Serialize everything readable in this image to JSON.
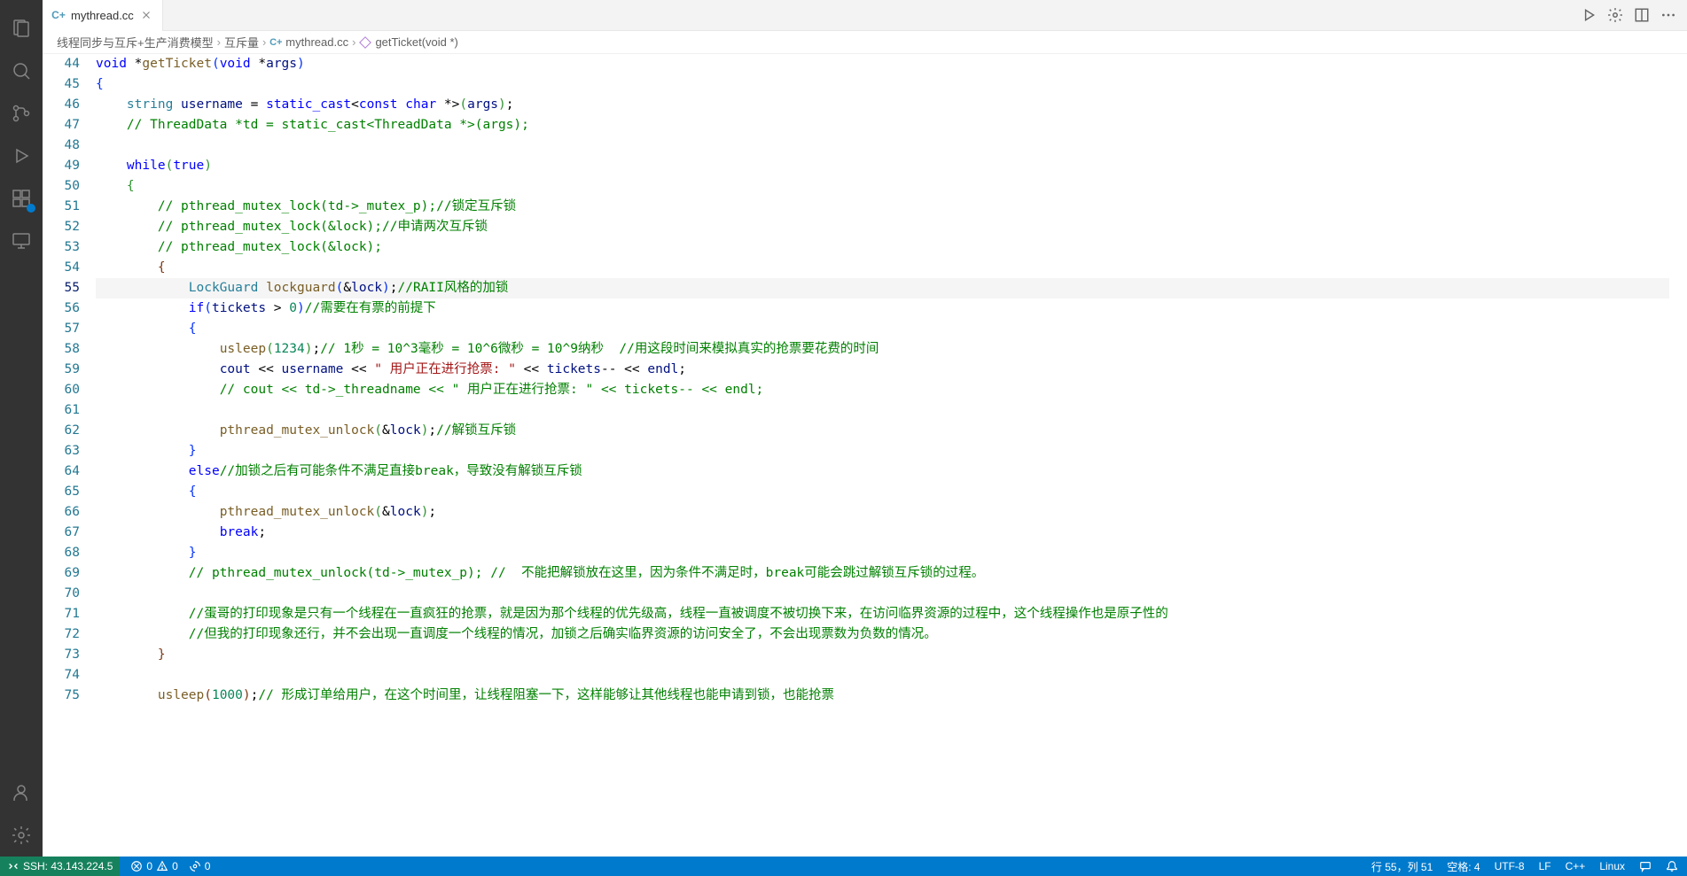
{
  "tab": {
    "filename": "mythread.cc",
    "iconLabel": "C+"
  },
  "breadcrumb": {
    "items": [
      {
        "label": "线程同步与互斥+生产消费模型",
        "type": "folder"
      },
      {
        "label": "互斥量",
        "type": "folder"
      },
      {
        "label": "mythread.cc",
        "type": "file",
        "icon": "C+"
      },
      {
        "label": "getTicket(void *)",
        "type": "symbol"
      }
    ]
  },
  "code": {
    "startLine": 44,
    "currentLine": 55,
    "lines": [
      {
        "num": 44,
        "tokens": [
          {
            "t": "kw",
            "v": "void"
          },
          {
            "t": "op",
            "v": " *"
          },
          {
            "t": "func",
            "v": "getTicket"
          },
          {
            "t": "paren",
            "v": "("
          },
          {
            "t": "kw",
            "v": "void"
          },
          {
            "t": "op",
            "v": " *"
          },
          {
            "t": "var",
            "v": "args"
          },
          {
            "t": "paren",
            "v": ")"
          }
        ]
      },
      {
        "num": 45,
        "tokens": [
          {
            "t": "paren",
            "v": "{"
          }
        ]
      },
      {
        "num": 46,
        "indent": 1,
        "tokens": [
          {
            "t": "type",
            "v": "string"
          },
          {
            "t": "op",
            "v": " "
          },
          {
            "t": "var",
            "v": "username"
          },
          {
            "t": "op",
            "v": " = "
          },
          {
            "t": "kw",
            "v": "static_cast"
          },
          {
            "t": "op",
            "v": "<"
          },
          {
            "t": "kw",
            "v": "const"
          },
          {
            "t": "op",
            "v": " "
          },
          {
            "t": "kw",
            "v": "char"
          },
          {
            "t": "op",
            "v": " *>"
          },
          {
            "t": "paren2",
            "v": "("
          },
          {
            "t": "var",
            "v": "args"
          },
          {
            "t": "paren2",
            "v": ")"
          },
          {
            "t": "op",
            "v": ";"
          }
        ]
      },
      {
        "num": 47,
        "indent": 1,
        "tokens": [
          {
            "t": "comment",
            "v": "// ThreadData *td = static_cast<ThreadData *>(args);"
          }
        ]
      },
      {
        "num": 48,
        "tokens": []
      },
      {
        "num": 49,
        "indent": 1,
        "tokens": [
          {
            "t": "kw",
            "v": "while"
          },
          {
            "t": "paren2",
            "v": "("
          },
          {
            "t": "kw",
            "v": "true"
          },
          {
            "t": "paren2",
            "v": ")"
          }
        ]
      },
      {
        "num": 50,
        "indent": 1,
        "tokens": [
          {
            "t": "paren2",
            "v": "{"
          }
        ]
      },
      {
        "num": 51,
        "indent": 2,
        "tokens": [
          {
            "t": "comment",
            "v": "// pthread_mutex_lock(td->_mutex_p);//锁定互斥锁"
          }
        ]
      },
      {
        "num": 52,
        "indent": 2,
        "tokens": [
          {
            "t": "comment",
            "v": "// pthread_mutex_lock(&lock);//申请两次互斥锁"
          }
        ]
      },
      {
        "num": 53,
        "indent": 2,
        "tokens": [
          {
            "t": "comment",
            "v": "// pthread_mutex_lock(&lock);"
          }
        ]
      },
      {
        "num": 54,
        "indent": 2,
        "tokens": [
          {
            "t": "paren3",
            "v": "{"
          }
        ]
      },
      {
        "num": 55,
        "indent": 3,
        "highlighted": true,
        "tokens": [
          {
            "t": "type",
            "v": "LockGuard"
          },
          {
            "t": "op",
            "v": " "
          },
          {
            "t": "func",
            "v": "lockguard"
          },
          {
            "t": "paren",
            "v": "("
          },
          {
            "t": "op",
            "v": "&"
          },
          {
            "t": "var",
            "v": "lock"
          },
          {
            "t": "paren",
            "v": ")"
          },
          {
            "t": "op",
            "v": ";"
          },
          {
            "t": "comment",
            "v": "//RAII风格的加锁"
          }
        ]
      },
      {
        "num": 56,
        "indent": 3,
        "tokens": [
          {
            "t": "kw",
            "v": "if"
          },
          {
            "t": "paren",
            "v": "("
          },
          {
            "t": "var",
            "v": "tickets"
          },
          {
            "t": "op",
            "v": " > "
          },
          {
            "t": "num",
            "v": "0"
          },
          {
            "t": "paren",
            "v": ")"
          },
          {
            "t": "comment",
            "v": "//需要在有票的前提下"
          }
        ]
      },
      {
        "num": 57,
        "indent": 3,
        "tokens": [
          {
            "t": "paren",
            "v": "{"
          }
        ]
      },
      {
        "num": 58,
        "indent": 4,
        "tokens": [
          {
            "t": "func",
            "v": "usleep"
          },
          {
            "t": "paren2",
            "v": "("
          },
          {
            "t": "num",
            "v": "1234"
          },
          {
            "t": "paren2",
            "v": ")"
          },
          {
            "t": "op",
            "v": ";"
          },
          {
            "t": "comment",
            "v": "// 1秒 = 10^3毫秒 = 10^6微秒 = 10^9纳秒  //用这段时间来模拟真实的抢票要花费的时间"
          }
        ]
      },
      {
        "num": 59,
        "indent": 4,
        "tokens": [
          {
            "t": "var",
            "v": "cout"
          },
          {
            "t": "op",
            "v": " << "
          },
          {
            "t": "var",
            "v": "username"
          },
          {
            "t": "op",
            "v": " << "
          },
          {
            "t": "str",
            "v": "\" 用户正在进行抢票: \""
          },
          {
            "t": "op",
            "v": " << "
          },
          {
            "t": "var",
            "v": "tickets"
          },
          {
            "t": "op",
            "v": "-- << "
          },
          {
            "t": "var",
            "v": "endl"
          },
          {
            "t": "op",
            "v": ";"
          }
        ]
      },
      {
        "num": 60,
        "indent": 4,
        "tokens": [
          {
            "t": "comment",
            "v": "// cout << td->_threadname << \" 用户正在进行抢票: \" << tickets-- << endl;"
          }
        ]
      },
      {
        "num": 61,
        "tokens": []
      },
      {
        "num": 62,
        "indent": 4,
        "tokens": [
          {
            "t": "func",
            "v": "pthread_mutex_unlock"
          },
          {
            "t": "paren2",
            "v": "("
          },
          {
            "t": "op",
            "v": "&"
          },
          {
            "t": "var",
            "v": "lock"
          },
          {
            "t": "paren2",
            "v": ")"
          },
          {
            "t": "op",
            "v": ";"
          },
          {
            "t": "comment",
            "v": "//解锁互斥锁"
          }
        ]
      },
      {
        "num": 63,
        "indent": 3,
        "tokens": [
          {
            "t": "paren",
            "v": "}"
          }
        ]
      },
      {
        "num": 64,
        "indent": 3,
        "tokens": [
          {
            "t": "kw",
            "v": "else"
          },
          {
            "t": "comment",
            "v": "//加锁之后有可能条件不满足直接break，导致没有解锁互斥锁"
          }
        ]
      },
      {
        "num": 65,
        "indent": 3,
        "tokens": [
          {
            "t": "paren",
            "v": "{"
          }
        ]
      },
      {
        "num": 66,
        "indent": 4,
        "tokens": [
          {
            "t": "func",
            "v": "pthread_mutex_unlock"
          },
          {
            "t": "paren2",
            "v": "("
          },
          {
            "t": "op",
            "v": "&"
          },
          {
            "t": "var",
            "v": "lock"
          },
          {
            "t": "paren2",
            "v": ")"
          },
          {
            "t": "op",
            "v": ";"
          }
        ]
      },
      {
        "num": 67,
        "indent": 4,
        "tokens": [
          {
            "t": "kw",
            "v": "break"
          },
          {
            "t": "op",
            "v": ";"
          }
        ]
      },
      {
        "num": 68,
        "indent": 3,
        "tokens": [
          {
            "t": "paren",
            "v": "}"
          }
        ]
      },
      {
        "num": 69,
        "indent": 3,
        "tokens": [
          {
            "t": "comment",
            "v": "// pthread_mutex_unlock(td->_mutex_p); //  不能把解锁放在这里，因为条件不满足时，break可能会跳过解锁互斥锁的过程。"
          }
        ]
      },
      {
        "num": 70,
        "tokens": []
      },
      {
        "num": 71,
        "indent": 3,
        "tokens": [
          {
            "t": "comment",
            "v": "//蛋哥的打印现象是只有一个线程在一直疯狂的抢票，就是因为那个线程的优先级高，线程一直被调度不被切换下来，在访问临界资源的过程中，这个线程操作也是原子性的"
          }
        ]
      },
      {
        "num": 72,
        "indent": 3,
        "tokens": [
          {
            "t": "comment",
            "v": "//但我的打印现象还行，并不会出现一直调度一个线程的情况，加锁之后确实临界资源的访问安全了，不会出现票数为负数的情况。"
          }
        ]
      },
      {
        "num": 73,
        "indent": 2,
        "tokens": [
          {
            "t": "paren3",
            "v": "}"
          }
        ]
      },
      {
        "num": 74,
        "tokens": []
      },
      {
        "num": 75,
        "indent": 2,
        "tokens": [
          {
            "t": "func",
            "v": "usleep"
          },
          {
            "t": "paren3",
            "v": "("
          },
          {
            "t": "num",
            "v": "1000"
          },
          {
            "t": "paren3",
            "v": ")"
          },
          {
            "t": "op",
            "v": ";"
          },
          {
            "t": "comment",
            "v": "// 形成订单给用户，在这个时间里，让线程阻塞一下，这样能够让其他线程也能申请到锁，也能抢票"
          }
        ]
      }
    ]
  },
  "statusBar": {
    "remote": "SSH: 43.143.224.5",
    "errors": "0",
    "warnings": "0",
    "ports": "0",
    "lineCol": "行 55，列 51",
    "spaces": "空格: 4",
    "encoding": "UTF-8",
    "eol": "LF",
    "language": "C++",
    "os": "Linux"
  }
}
